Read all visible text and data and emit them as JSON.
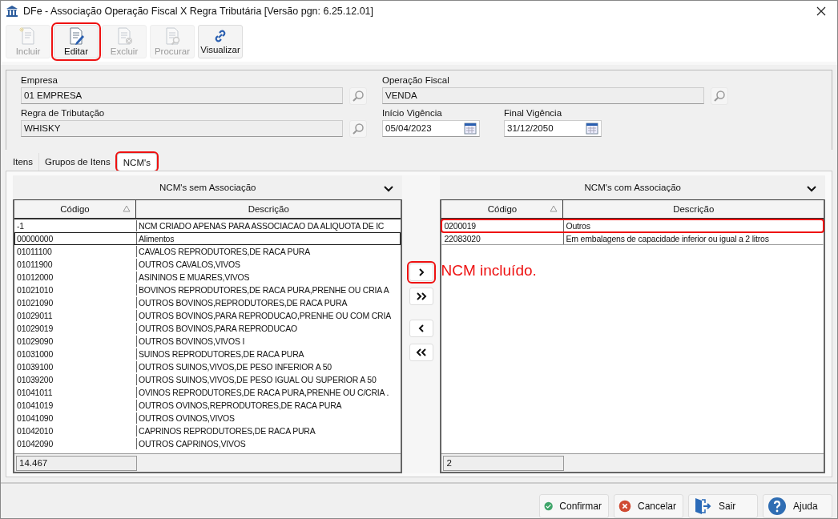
{
  "window": {
    "title": "DFe - Associação Operação Fiscal X Regra Tributária [Versão pgn: 6.25.12.01]"
  },
  "toolbar": [
    {
      "kind": "new",
      "label": "Incluir",
      "disabled": true,
      "highlighted": false
    },
    {
      "kind": "edit",
      "label": "Editar",
      "disabled": false,
      "highlighted": true
    },
    {
      "kind": "delete",
      "label": "Excluir",
      "disabled": true,
      "highlighted": false
    },
    {
      "kind": "find",
      "label": "Procurar",
      "disabled": true,
      "highlighted": false
    },
    {
      "kind": "view",
      "label": "Visualizar",
      "disabled": false,
      "highlighted": false
    }
  ],
  "form": {
    "empresa": {
      "label": "Empresa",
      "value": "01 EMPRESA"
    },
    "regra_tributacao": {
      "label": "Regra de Tributação",
      "value": "WHISKY"
    },
    "operacao_fiscal": {
      "label": "Operação Fiscal",
      "value": "VENDA"
    },
    "inicio_vigencia": {
      "label": "Início Vigência",
      "value": "05/04/2023"
    },
    "final_vigencia": {
      "label": "Final Vigência",
      "value": "31/12/2050"
    }
  },
  "tabs": [
    {
      "label": "Itens",
      "selected": false,
      "highlighted": false
    },
    {
      "label": "Grupos de Itens",
      "selected": false,
      "highlighted": false
    },
    {
      "label": "NCM's",
      "selected": true,
      "highlighted": true
    }
  ],
  "left_list": {
    "title": "NCM's sem Associação",
    "columns": [
      "Código",
      "Descrição"
    ],
    "rows": [
      {
        "code": "-1",
        "description": "NCM CRIADO APENAS PARA ASSOCIACAO DA ALIQUOTA DE IC",
        "selected": false,
        "highlighted": false
      },
      {
        "code": "00000000",
        "description": "Alimentos",
        "selected": true,
        "highlighted": false
      },
      {
        "code": "01011100",
        "description": "CAVALOS REPRODUTORES,DE RACA PURA",
        "selected": false,
        "highlighted": false
      },
      {
        "code": "01011900",
        "description": "OUTROS CAVALOS,VIVOS",
        "selected": false,
        "highlighted": false
      },
      {
        "code": "01012000",
        "description": "ASININOS E MUARES,VIVOS",
        "selected": false,
        "highlighted": false
      },
      {
        "code": "01021010",
        "description": "BOVINOS REPRODUTORES,DE RACA PURA,PRENHE OU CRIA A",
        "selected": false,
        "highlighted": false
      },
      {
        "code": "01021090",
        "description": "OUTROS BOVINOS,REPRODUTORES,DE RACA PURA",
        "selected": false,
        "highlighted": false
      },
      {
        "code": "01029011",
        "description": "OUTROS BOVINOS,PARA REPRODUCAO,PRENHE OU COM CRIA",
        "selected": false,
        "highlighted": false
      },
      {
        "code": "01029019",
        "description": "OUTROS BOVINOS,PARA REPRODUCAO",
        "selected": false,
        "highlighted": false
      },
      {
        "code": "01029090",
        "description": "OUTROS BOVINOS,VIVOS I",
        "selected": false,
        "highlighted": false
      },
      {
        "code": "01031000",
        "description": "SUINOS REPRODUTORES,DE RACA PURA",
        "selected": false,
        "highlighted": false
      },
      {
        "code": "01039100",
        "description": "OUTROS SUINOS,VIVOS,DE PESO INFERIOR A 50",
        "selected": false,
        "highlighted": false
      },
      {
        "code": "01039200",
        "description": "OUTROS SUINOS,VIVOS,DE PESO IGUAL OU SUPERIOR A 50",
        "selected": false,
        "highlighted": false
      },
      {
        "code": "01041011",
        "description": "OVINOS REPRODUTORES,DE RACA PURA,PRENHE OU C/CRIA .",
        "selected": false,
        "highlighted": false
      },
      {
        "code": "01041019",
        "description": "OUTROS OVINOS,REPRODUTORES,DE RACA PURA",
        "selected": false,
        "highlighted": false
      },
      {
        "code": "01041090",
        "description": "OUTROS OVINOS,VIVOS",
        "selected": false,
        "highlighted": false
      },
      {
        "code": "01042010",
        "description": "CAPRINOS REPRODUTORES,DE RACA PURA",
        "selected": false,
        "highlighted": false
      },
      {
        "code": "01042090",
        "description": "OUTROS CAPRINOS,VIVOS",
        "selected": false,
        "highlighted": false
      }
    ],
    "count": "14.467"
  },
  "transfer_buttons": [
    {
      "kind": "add",
      "highlighted": true
    },
    {
      "kind": "add_all",
      "highlighted": false
    },
    {
      "kind": "remove",
      "highlighted": false
    },
    {
      "kind": "remove_all",
      "highlighted": false
    }
  ],
  "annotation": {
    "text": "NCM incluído."
  },
  "right_list": {
    "title": "NCM's com Associação",
    "columns": [
      "Código",
      "Descrição"
    ],
    "rows": [
      {
        "code": "0200019",
        "description": "Outros",
        "selected": false,
        "highlighted": true
      },
      {
        "code": "22083020",
        "description": "Em embalagens de capacidade inferior ou igual a 2 litros",
        "selected": false,
        "highlighted": false
      }
    ],
    "count": "2"
  },
  "footer_buttons": [
    {
      "kind": "confirm",
      "label": "Confirmar"
    },
    {
      "kind": "cancel",
      "label": "Cancelar"
    },
    {
      "kind": "exit",
      "label": "Sair"
    },
    {
      "kind": "help",
      "label": "Ajuda"
    }
  ]
}
